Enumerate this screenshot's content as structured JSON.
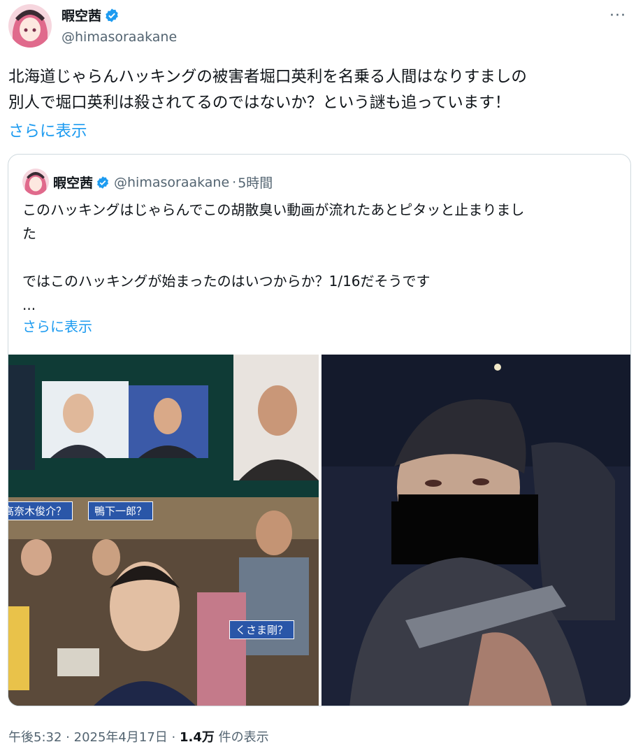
{
  "tweet": {
    "display_name": "暇空茜",
    "handle": "@himasoraakane",
    "more": "···",
    "text": "北海道じゃらんハッキングの被害者堀口英利を名乗る人間はなりすましの\n別人で堀口英利は殺されてるのではないか？という謎も追っています！",
    "show_more": "さらに表示"
  },
  "quote": {
    "display_name": "暇空茜",
    "handle": "@himasoraakane",
    "dot": "·",
    "time": "5時間",
    "text": "このハッキングはじゃらんでこの胡散臭い動画が流れたあとピタッと止まりまし\nた\n\nではこのハッキングが始まったのはいつからか？1/16だそうです\n...",
    "show_more": "さらに表示",
    "media_labels": {
      "left_1": "高奈木俊介？",
      "left_2": "鴨下一郎？",
      "left_3": "くさま剛？"
    }
  },
  "footer": {
    "time": "午後5:32",
    "sep1": "·",
    "date": "2025年4月17日",
    "sep2": "·",
    "views_count": "1.4万",
    "views_label": "件の表示"
  },
  "colors": {
    "accent": "#1d9bf0",
    "muted": "#536471",
    "text": "#0f1419",
    "border": "#cfd9de",
    "label_bg": "#2a56a8"
  }
}
